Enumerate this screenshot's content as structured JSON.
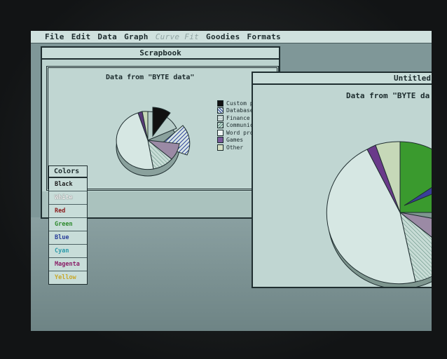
{
  "menubar": {
    "apple_glyph": "",
    "items": [
      {
        "label": "File",
        "enabled": true
      },
      {
        "label": "Edit",
        "enabled": true
      },
      {
        "label": "Data",
        "enabled": true
      },
      {
        "label": "Graph",
        "enabled": true
      },
      {
        "label": "Curve Fit",
        "enabled": false
      },
      {
        "label": "Goodies",
        "enabled": true
      },
      {
        "label": "Formats",
        "enabled": true
      }
    ]
  },
  "scrapbook": {
    "title": "Scrapbook",
    "chart_title": "Data from \"BYTE data\"",
    "legend": [
      {
        "label": "Custom p",
        "pattern": "black"
      },
      {
        "label": "Database",
        "pattern": "diag"
      },
      {
        "label": "Finance",
        "pattern": "dots"
      },
      {
        "label": "Communic",
        "pattern": "hatch"
      },
      {
        "label": "Word proc",
        "pattern": "white"
      },
      {
        "label": "Games",
        "pattern": "purple"
      },
      {
        "label": "Other",
        "pattern": "light"
      }
    ]
  },
  "untitled": {
    "title": "Untitled",
    "chart_title": "Data from \"BYTE da"
  },
  "palette": {
    "title": "Colors",
    "items": [
      {
        "label": "Black",
        "color": "#1c1c1c"
      },
      {
        "label": "White",
        "color": "#f4f4f4"
      },
      {
        "label": "Red",
        "color": "#b02020"
      },
      {
        "label": "Green",
        "color": "#2e8a2e"
      },
      {
        "label": "Blue",
        "color": "#2a3f9a"
      },
      {
        "label": "Cyan",
        "color": "#2a9aaa"
      },
      {
        "label": "Magenta",
        "color": "#8a2068"
      },
      {
        "label": "Yellow",
        "color": "#c8a82a"
      }
    ]
  },
  "colors": {
    "screen": "#7f9798",
    "window": "#bcd3cf",
    "green_slice": "#3a9a2e",
    "blue_slice": "#3a3f9a",
    "purple_slice": "#6a3a8a"
  }
}
